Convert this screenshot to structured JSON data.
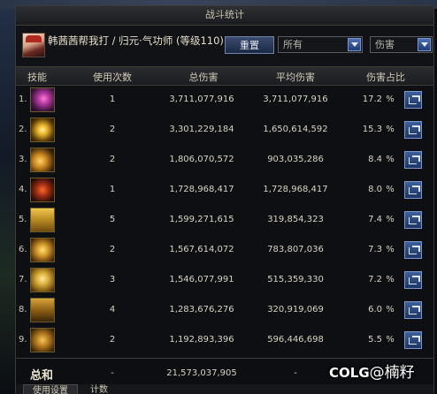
{
  "window": {
    "title": "战斗统计"
  },
  "header": {
    "character_name": "韩茜茜帮我打 / 归元·气功师 (等级110)",
    "reset_label": "重置",
    "filter_select": "所有",
    "metric_select": "伤害"
  },
  "columns": [
    "技能",
    "使用次数",
    "总伤害",
    "平均伤害",
    "伤害占比"
  ],
  "rows": [
    {
      "index": "1.",
      "icon": "skill-icon-1",
      "uses": "1",
      "total": "3,711,077,916",
      "avg": "3,711,077,916",
      "pct": "17.2",
      "pct_unit": "%"
    },
    {
      "index": "2.",
      "icon": "skill-icon-2",
      "uses": "2",
      "total": "3,301,229,184",
      "avg": "1,650,614,592",
      "pct": "15.3",
      "pct_unit": "%"
    },
    {
      "index": "3.",
      "icon": "skill-icon-3",
      "uses": "2",
      "total": "1,806,070,572",
      "avg": "903,035,286",
      "pct": "8.4",
      "pct_unit": "%"
    },
    {
      "index": "4.",
      "icon": "skill-icon-4",
      "uses": "1",
      "total": "1,728,968,417",
      "avg": "1,728,968,417",
      "pct": "8.0",
      "pct_unit": "%"
    },
    {
      "index": "5.",
      "icon": "skill-icon-5",
      "uses": "5",
      "total": "1,599,271,615",
      "avg": "319,854,323",
      "pct": "7.4",
      "pct_unit": "%"
    },
    {
      "index": "6.",
      "icon": "skill-icon-6",
      "uses": "2",
      "total": "1,567,614,072",
      "avg": "783,807,036",
      "pct": "7.3",
      "pct_unit": "%"
    },
    {
      "index": "7.",
      "icon": "skill-icon-7",
      "uses": "3",
      "total": "1,546,077,991",
      "avg": "515,359,330",
      "pct": "7.2",
      "pct_unit": "%"
    },
    {
      "index": "8.",
      "icon": "skill-icon-8",
      "uses": "4",
      "total": "1,283,676,276",
      "avg": "320,919,069",
      "pct": "6.0",
      "pct_unit": "%"
    },
    {
      "index": "9.",
      "icon": "skill-icon-9",
      "uses": "2",
      "total": "1,192,893,396",
      "avg": "596,446,698",
      "pct": "5.5",
      "pct_unit": "%"
    }
  ],
  "total": {
    "label": "总和",
    "uses": "-",
    "total": "21,573,037,905",
    "avg": "-"
  },
  "tabs": [
    "使用设置",
    "计数"
  ],
  "watermark": {
    "logo": "COLG",
    "text": "@楠籽"
  }
}
